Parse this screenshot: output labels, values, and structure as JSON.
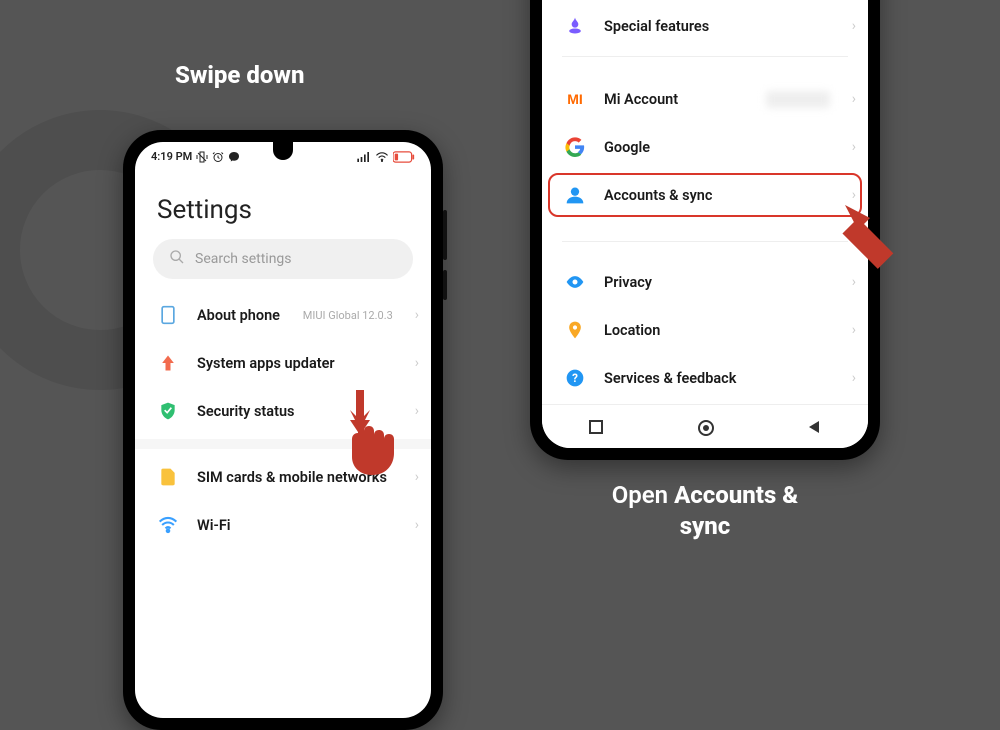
{
  "captions": {
    "left": "Swipe down",
    "right_pre": "Open ",
    "right_bold": "Accounts & sync"
  },
  "phone_left": {
    "status": {
      "time": "4:19 PM"
    },
    "title": "Settings",
    "search_placeholder": "Search settings",
    "rows": {
      "about": {
        "label": "About phone",
        "sub": "MIUI Global 12.0.3"
      },
      "updater": {
        "label": "System apps updater"
      },
      "security": {
        "label": "Security status"
      },
      "sim": {
        "label": "SIM cards & mobile networks"
      },
      "wifi": {
        "label": "Wi-Fi"
      }
    }
  },
  "phone_right": {
    "rows": {
      "special": {
        "label": "Special features"
      },
      "mi": {
        "label": "Mi Account"
      },
      "google": {
        "label": "Google"
      },
      "accounts": {
        "label": "Accounts & sync"
      },
      "privacy": {
        "label": "Privacy"
      },
      "location": {
        "label": "Location"
      },
      "services": {
        "label": "Services & feedback"
      }
    }
  }
}
